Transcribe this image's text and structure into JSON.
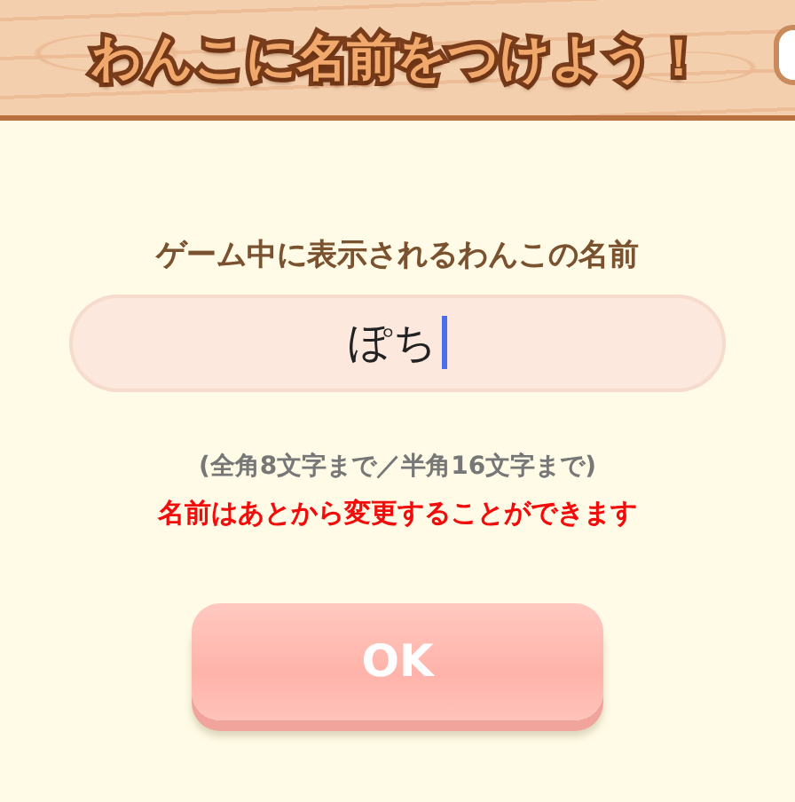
{
  "header": {
    "title": "わんこに名前をつけよう！"
  },
  "form": {
    "label": "ゲーム中に表示されるわんこの名前",
    "name_field": {
      "value": "ぽち",
      "focused": true
    },
    "hint": "(全角8文字まで／半角16文字まで)",
    "notice": "名前はあとから変更することができます"
  },
  "buttons": [
    {
      "label": "OK"
    }
  ]
}
